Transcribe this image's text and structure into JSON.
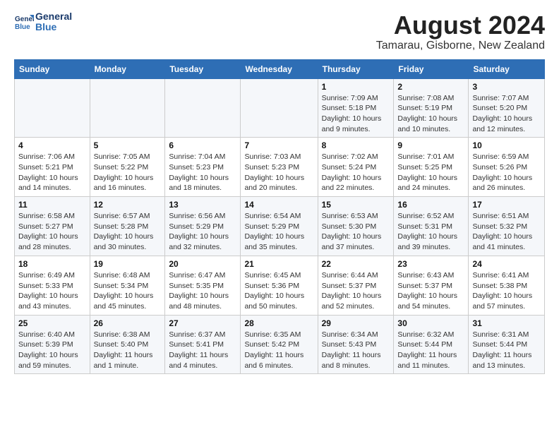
{
  "header": {
    "logo_line1": "General",
    "logo_line2": "Blue",
    "month_title": "August 2024",
    "location": "Tamarau, Gisborne, New Zealand"
  },
  "columns": [
    "Sunday",
    "Monday",
    "Tuesday",
    "Wednesday",
    "Thursday",
    "Friday",
    "Saturday"
  ],
  "rows": [
    [
      {
        "day": "",
        "info": ""
      },
      {
        "day": "",
        "info": ""
      },
      {
        "day": "",
        "info": ""
      },
      {
        "day": "",
        "info": ""
      },
      {
        "day": "1",
        "info": "Sunrise: 7:09 AM\nSunset: 5:18 PM\nDaylight: 10 hours\nand 9 minutes."
      },
      {
        "day": "2",
        "info": "Sunrise: 7:08 AM\nSunset: 5:19 PM\nDaylight: 10 hours\nand 10 minutes."
      },
      {
        "day": "3",
        "info": "Sunrise: 7:07 AM\nSunset: 5:20 PM\nDaylight: 10 hours\nand 12 minutes."
      }
    ],
    [
      {
        "day": "4",
        "info": "Sunrise: 7:06 AM\nSunset: 5:21 PM\nDaylight: 10 hours\nand 14 minutes."
      },
      {
        "day": "5",
        "info": "Sunrise: 7:05 AM\nSunset: 5:22 PM\nDaylight: 10 hours\nand 16 minutes."
      },
      {
        "day": "6",
        "info": "Sunrise: 7:04 AM\nSunset: 5:23 PM\nDaylight: 10 hours\nand 18 minutes."
      },
      {
        "day": "7",
        "info": "Sunrise: 7:03 AM\nSunset: 5:23 PM\nDaylight: 10 hours\nand 20 minutes."
      },
      {
        "day": "8",
        "info": "Sunrise: 7:02 AM\nSunset: 5:24 PM\nDaylight: 10 hours\nand 22 minutes."
      },
      {
        "day": "9",
        "info": "Sunrise: 7:01 AM\nSunset: 5:25 PM\nDaylight: 10 hours\nand 24 minutes."
      },
      {
        "day": "10",
        "info": "Sunrise: 6:59 AM\nSunset: 5:26 PM\nDaylight: 10 hours\nand 26 minutes."
      }
    ],
    [
      {
        "day": "11",
        "info": "Sunrise: 6:58 AM\nSunset: 5:27 PM\nDaylight: 10 hours\nand 28 minutes."
      },
      {
        "day": "12",
        "info": "Sunrise: 6:57 AM\nSunset: 5:28 PM\nDaylight: 10 hours\nand 30 minutes."
      },
      {
        "day": "13",
        "info": "Sunrise: 6:56 AM\nSunset: 5:29 PM\nDaylight: 10 hours\nand 32 minutes."
      },
      {
        "day": "14",
        "info": "Sunrise: 6:54 AM\nSunset: 5:29 PM\nDaylight: 10 hours\nand 35 minutes."
      },
      {
        "day": "15",
        "info": "Sunrise: 6:53 AM\nSunset: 5:30 PM\nDaylight: 10 hours\nand 37 minutes."
      },
      {
        "day": "16",
        "info": "Sunrise: 6:52 AM\nSunset: 5:31 PM\nDaylight: 10 hours\nand 39 minutes."
      },
      {
        "day": "17",
        "info": "Sunrise: 6:51 AM\nSunset: 5:32 PM\nDaylight: 10 hours\nand 41 minutes."
      }
    ],
    [
      {
        "day": "18",
        "info": "Sunrise: 6:49 AM\nSunset: 5:33 PM\nDaylight: 10 hours\nand 43 minutes."
      },
      {
        "day": "19",
        "info": "Sunrise: 6:48 AM\nSunset: 5:34 PM\nDaylight: 10 hours\nand 45 minutes."
      },
      {
        "day": "20",
        "info": "Sunrise: 6:47 AM\nSunset: 5:35 PM\nDaylight: 10 hours\nand 48 minutes."
      },
      {
        "day": "21",
        "info": "Sunrise: 6:45 AM\nSunset: 5:36 PM\nDaylight: 10 hours\nand 50 minutes."
      },
      {
        "day": "22",
        "info": "Sunrise: 6:44 AM\nSunset: 5:37 PM\nDaylight: 10 hours\nand 52 minutes."
      },
      {
        "day": "23",
        "info": "Sunrise: 6:43 AM\nSunset: 5:37 PM\nDaylight: 10 hours\nand 54 minutes."
      },
      {
        "day": "24",
        "info": "Sunrise: 6:41 AM\nSunset: 5:38 PM\nDaylight: 10 hours\nand 57 minutes."
      }
    ],
    [
      {
        "day": "25",
        "info": "Sunrise: 6:40 AM\nSunset: 5:39 PM\nDaylight: 10 hours\nand 59 minutes."
      },
      {
        "day": "26",
        "info": "Sunrise: 6:38 AM\nSunset: 5:40 PM\nDaylight: 11 hours\nand 1 minute."
      },
      {
        "day": "27",
        "info": "Sunrise: 6:37 AM\nSunset: 5:41 PM\nDaylight: 11 hours\nand 4 minutes."
      },
      {
        "day": "28",
        "info": "Sunrise: 6:35 AM\nSunset: 5:42 PM\nDaylight: 11 hours\nand 6 minutes."
      },
      {
        "day": "29",
        "info": "Sunrise: 6:34 AM\nSunset: 5:43 PM\nDaylight: 11 hours\nand 8 minutes."
      },
      {
        "day": "30",
        "info": "Sunrise: 6:32 AM\nSunset: 5:44 PM\nDaylight: 11 hours\nand 11 minutes."
      },
      {
        "day": "31",
        "info": "Sunrise: 6:31 AM\nSunset: 5:44 PM\nDaylight: 11 hours\nand 13 minutes."
      }
    ]
  ]
}
